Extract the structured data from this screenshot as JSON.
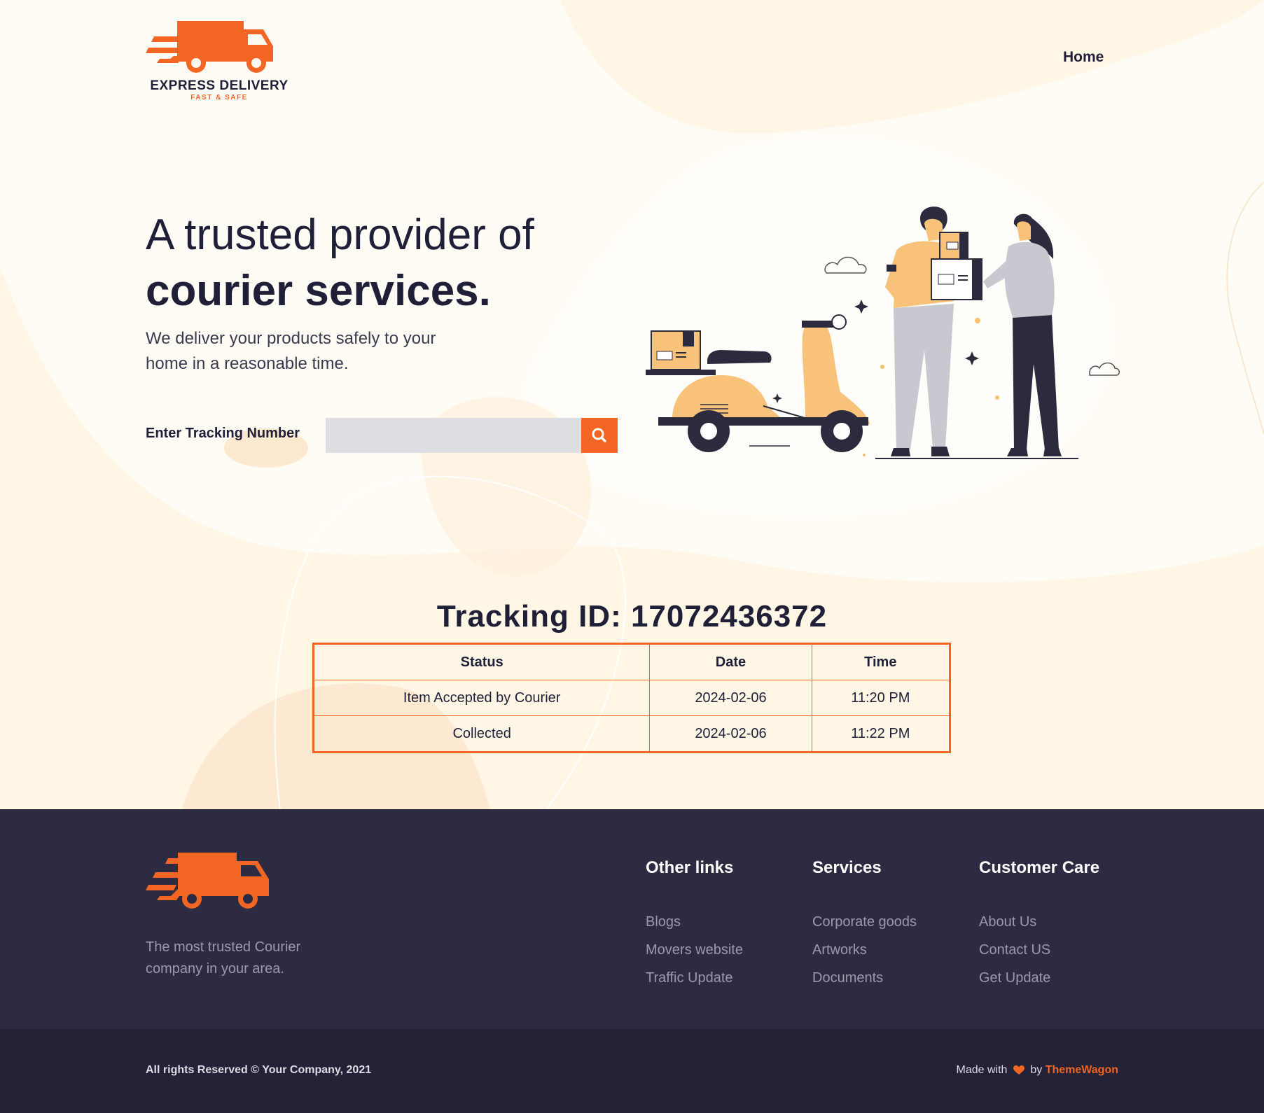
{
  "brand": {
    "name": "EXPRESS DELIVERY",
    "tagline": "FAST & SAFE",
    "accent_color": "#f26522",
    "dark_color": "#1f1f38"
  },
  "nav": {
    "home": "Home"
  },
  "hero": {
    "title_line1": "A trusted provider of",
    "title_line2": "courier services.",
    "subtitle": "We deliver your products safely to your home in a reasonable time."
  },
  "tracking_form": {
    "label": "Enter Tracking Number",
    "input_value": "",
    "search_icon": "search-icon"
  },
  "tracking_result": {
    "heading": "Tracking ID: 17072436372",
    "columns": [
      "Status",
      "Date",
      "Time"
    ],
    "rows": [
      [
        "Item Accepted by Courier",
        "2024-02-06",
        "11:20 PM"
      ],
      [
        "Collected",
        "2024-02-06",
        "11:22 PM"
      ]
    ]
  },
  "footer": {
    "description": "The most trusted Courier company in your area.",
    "columns": [
      {
        "title": "Other links",
        "links": [
          "Blogs",
          "Movers website",
          "Traffic Update"
        ]
      },
      {
        "title": "Services",
        "links": [
          "Corporate goods",
          "Artworks",
          "Documents"
        ]
      },
      {
        "title": "Customer Care",
        "links": [
          "About Us",
          "Contact US",
          "Get Update"
        ]
      }
    ],
    "copyright": "All rights Reserved © Your Company, 2021",
    "made_with": "Made with",
    "by": "by",
    "credit": "ThemeWagon",
    "heart_icon": "heart-icon",
    "bg_color": "#2c2b41",
    "bottom_bg_color": "#232236"
  }
}
